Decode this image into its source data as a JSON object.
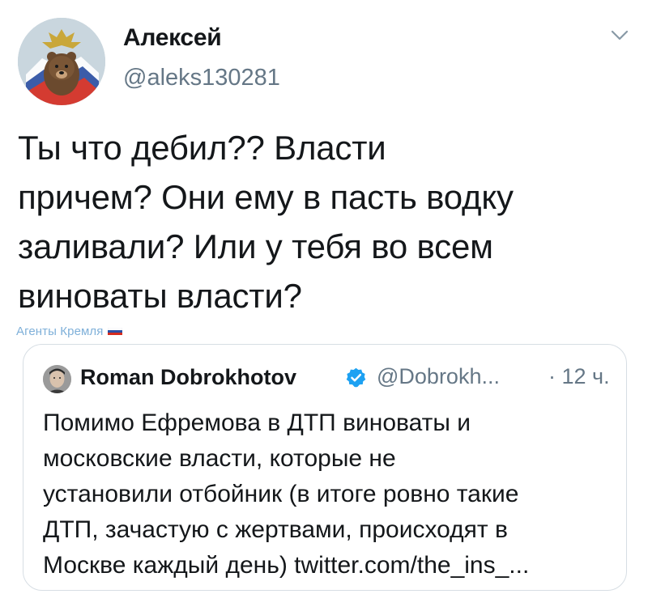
{
  "tweet": {
    "author_name": "Алексей",
    "author_handle": "@aleks130281",
    "text_lines": [
      "Ты что дебил?? Власти",
      "причем? Они ему в пасть водку",
      "заливали? Или у тебя во всем",
      "виноваты власти?"
    ],
    "menu_icon": "chevron-down-icon"
  },
  "watermark": {
    "text": "Агенты Кремля",
    "flag_icon": "russian-flag-icon",
    "color": "#7fb0d9"
  },
  "quoted_tweet": {
    "author_name": "Roman Dobrokhotov",
    "verified_icon": "verified-badge-icon",
    "author_handle": "@Dobrokh...",
    "time": "· 12 ч.",
    "text_lines": [
      "Помимо Ефремова в ДТП виноваты и",
      "московские власти, которые не",
      "установили отбойник (в итоге ровно такие",
      "ДТП, зачастую с жертвами, происходят в",
      "Москве каждый день) twitter.com/the_ins_..."
    ]
  },
  "colors": {
    "text_primary": "#14171a",
    "text_secondary": "#657786",
    "border": "#d7dee4",
    "verified_blue": "#1da1f2"
  }
}
